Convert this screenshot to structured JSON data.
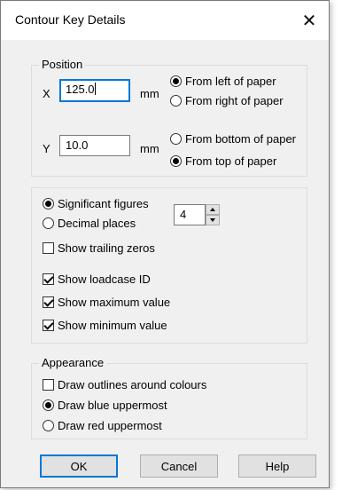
{
  "window": {
    "title": "Contour Key Details",
    "close_glyph": "✕"
  },
  "position": {
    "legend": "Position",
    "x_label": "X",
    "x_value": "125.0",
    "x_unit": "mm",
    "y_label": "Y",
    "y_value": "10.0",
    "y_unit": "mm",
    "horizontal_options": [
      {
        "label": "From left of paper",
        "selected": true
      },
      {
        "label": "From right of paper",
        "selected": false
      }
    ],
    "vertical_options": [
      {
        "label": "From bottom of paper",
        "selected": false
      },
      {
        "label": "From top of paper",
        "selected": true
      }
    ]
  },
  "format": {
    "significant_figures_label": "Significant figures",
    "significant_figures_selected": true,
    "decimal_places_label": "Decimal places",
    "decimal_places_selected": false,
    "digits_value": "4",
    "show_trailing_zeros": {
      "label": "Show trailing zeros",
      "checked": false
    },
    "show_loadcase_id": {
      "label": "Show loadcase ID",
      "checked": true
    },
    "show_maximum_value": {
      "label": "Show maximum value",
      "checked": true
    },
    "show_minimum_value": {
      "label": "Show minimum value",
      "checked": true
    }
  },
  "appearance": {
    "legend": "Appearance",
    "draw_outlines": {
      "label": "Draw outlines around colours",
      "checked": false
    },
    "draw_blue_uppermost": {
      "label": "Draw blue uppermost",
      "selected": true
    },
    "draw_red_uppermost": {
      "label": "Draw red uppermost",
      "selected": false
    }
  },
  "buttons": {
    "ok": "OK",
    "cancel": "Cancel",
    "help": "Help"
  },
  "colors": {
    "focus_border": "#0078d7",
    "dialog_bg": "#f0f0f0"
  }
}
